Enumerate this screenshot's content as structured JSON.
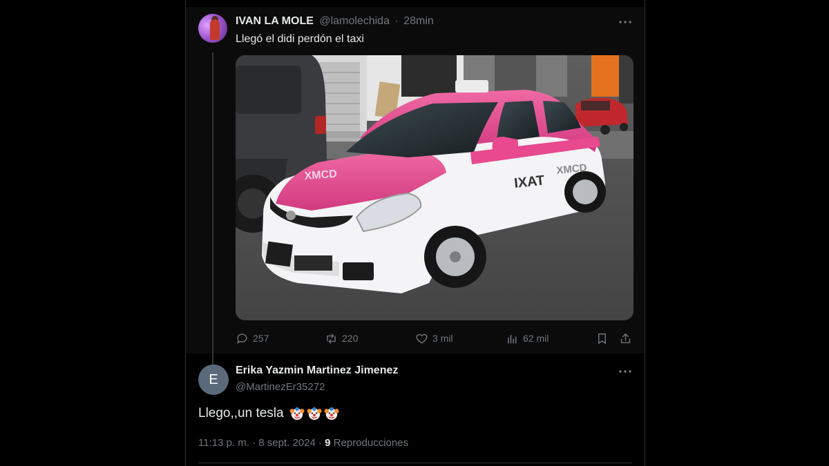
{
  "tweet": {
    "display_name": "IVAN LA MOLE",
    "handle": "@lamolechida",
    "separator": "·",
    "time": "28min",
    "text": "Llegó el didi perdón el taxi",
    "media": {
      "taxi_door_label": "IXAT",
      "taxi_hood_label": "XMCD",
      "taxi_door_logo": "XMCD"
    },
    "actions": {
      "replies": "257",
      "reposts": "220",
      "likes": "3 mil",
      "views": "62 mil"
    }
  },
  "reply": {
    "avatar_letter": "E",
    "display_name": "Erika Yazmin Martinez Jimenez",
    "handle": "@MartinezEr35272",
    "text": "Llego,,un tesla",
    "emoji": [
      "clown-face",
      "clown-face",
      "clown-face"
    ],
    "timestamp": "11:13 p. m. · 8 sept. 2024 · ",
    "views_count": "9",
    "views_label": " Reproducciones"
  },
  "icons": {
    "more": "more-dots-icon",
    "reply": "reply-icon",
    "repost": "repost-icon",
    "like": "heart-icon",
    "views": "analytics-icon",
    "bookmark": "bookmark-icon",
    "share": "share-icon"
  },
  "colors": {
    "background": "#000000",
    "text": "#e7e9ea",
    "muted": "#71767b",
    "taxi_pink": "#e8498f"
  }
}
